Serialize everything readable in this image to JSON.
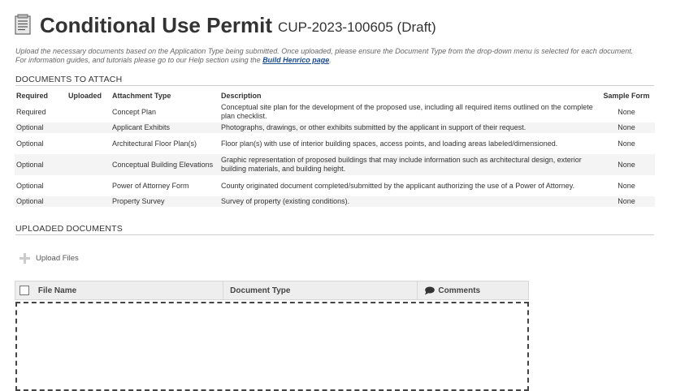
{
  "header": {
    "title": "Conditional Use Permit",
    "subtitle": "CUP-2023-100605 (Draft)"
  },
  "instructions": {
    "line1": "Upload the necessary documents based on the Application Type being submitted. Once uploaded, please ensure the Document Type from the drop-down menu is selected for each document.",
    "line2_prefix": "For information guides, and tutorials please go to our Help section using the ",
    "link_text": "Build Henrico page",
    "line2_suffix": "."
  },
  "documents_section": {
    "title": "DOCUMENTS TO ATTACH",
    "columns": [
      "Required",
      "Uploaded",
      "Attachment Type",
      "Description",
      "Sample Form"
    ],
    "rows": [
      {
        "required": "Required",
        "uploaded": "",
        "type": "Concept Plan",
        "description": "Conceptual site plan for the development of the proposed use, including all required items outlined on the complete plan checklist.",
        "sample": "None"
      },
      {
        "required": "Optional",
        "uploaded": "",
        "type": "Applicant Exhibits",
        "description": "Photographs, drawings, or other exhibits submitted by the applicant in support of their request.",
        "sample": "None"
      },
      {
        "required": "Optional",
        "uploaded": "",
        "type": "Architectural Floor Plan(s)",
        "description": "Floor plan(s) with use of interior building spaces, access points, and loading areas labeled/dimensioned.",
        "sample": "None"
      },
      {
        "required": "Optional",
        "uploaded": "",
        "type": "Conceptual Building Elevations",
        "description": "Graphic representation of proposed buildings that may include information such as architectural design, exterior building materials, and building height.",
        "sample": "None"
      },
      {
        "required": "Optional",
        "uploaded": "",
        "type": "Power of Attorney Form",
        "description": "County originated document completed/submitted by the applicant authorizing the use of a Power of Attorney.",
        "sample": "None"
      },
      {
        "required": "Optional",
        "uploaded": "",
        "type": "Property Survey",
        "description": "Survey of property (existing conditions).",
        "sample": "None"
      }
    ]
  },
  "uploaded_section": {
    "title": "UPLOADED DOCUMENTS",
    "upload_label": "Upload Files",
    "columns": {
      "file_name": "File Name",
      "document_type": "Document Type",
      "comments": "Comments"
    }
  },
  "icons": {
    "page": "document-icon",
    "upload": "plus-icon",
    "comments": "comment-bubble-icon"
  }
}
